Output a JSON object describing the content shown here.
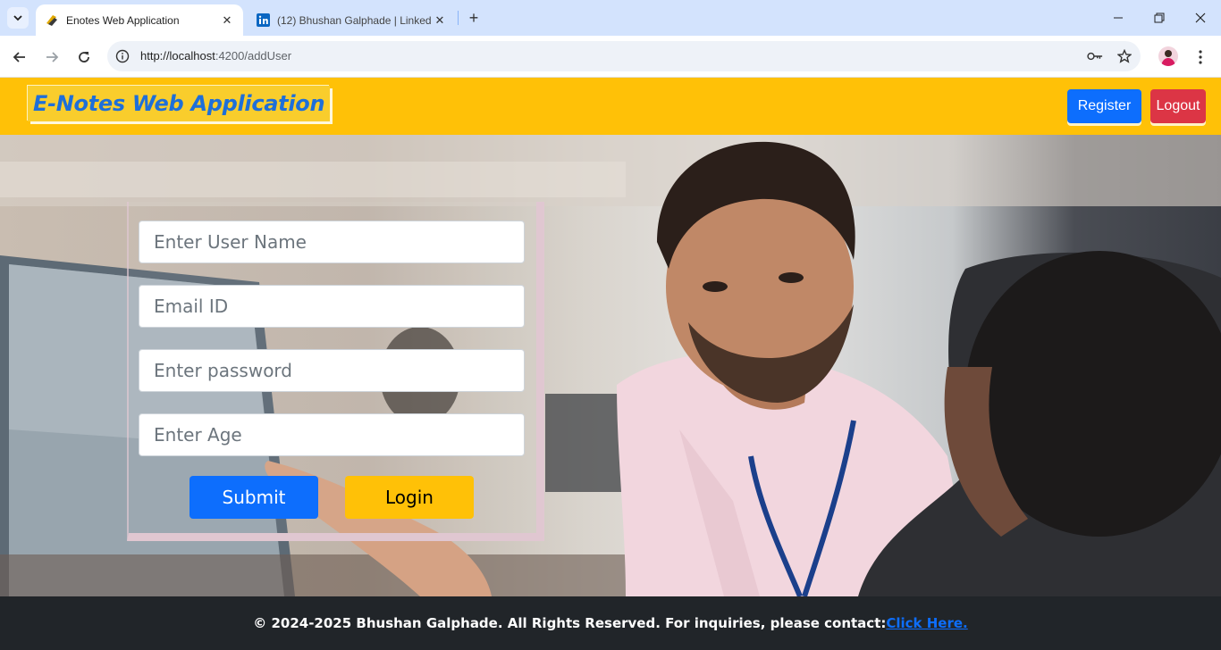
{
  "browser": {
    "tabs": [
      {
        "title": "Enotes Web Application",
        "active": true
      },
      {
        "title": "(12) Bhushan Galphade | Linked",
        "active": false
      }
    ],
    "url": {
      "host": "http://localhost",
      "rest": ":4200/addUser"
    }
  },
  "navbar": {
    "brand": "E-Notes Web Application",
    "register_label": "Register",
    "logout_label": "Logout"
  },
  "form": {
    "username_placeholder": "Enter User Name",
    "email_placeholder": "Email ID",
    "password_placeholder": "Enter password",
    "age_placeholder": "Enter Age",
    "submit_label": "Submit",
    "login_label": "Login"
  },
  "footer": {
    "text": "© 2024-2025 Bhushan Galphade. All Rights Reserved. For inquiries, please contact:",
    "link_label": "Click Here."
  },
  "colors": {
    "navbar": "#ffc107",
    "brand_text": "#1e6fd9",
    "primary": "#0d6efd",
    "danger": "#dc3545",
    "footer": "#212529"
  },
  "icons": [
    "tab-search-icon",
    "enotes-favicon",
    "linkedin-icon",
    "close-icon",
    "new-tab-icon",
    "minimize-icon",
    "restore-icon",
    "window-close-icon",
    "back-icon",
    "forward-icon",
    "reload-icon",
    "site-info-icon",
    "password-key-icon",
    "bookmark-star-icon",
    "profile-avatar",
    "more-menu-icon"
  ]
}
